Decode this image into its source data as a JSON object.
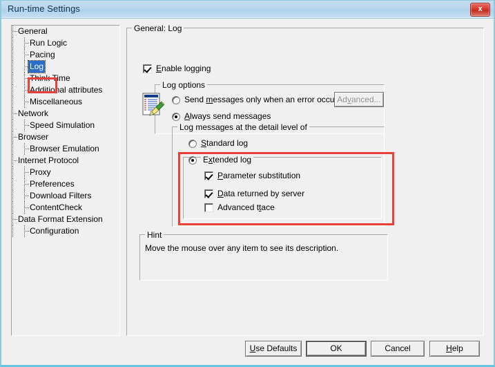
{
  "window": {
    "title": "Run-time Settings",
    "close_label": "x"
  },
  "tree": {
    "items": [
      {
        "label": "General",
        "level": 1,
        "selected": false
      },
      {
        "label": "Run Logic",
        "level": 2,
        "selected": false
      },
      {
        "label": "Pacing",
        "level": 2,
        "selected": false
      },
      {
        "label": "Log",
        "level": 2,
        "selected": true
      },
      {
        "label": "Think Time",
        "level": 2,
        "selected": false
      },
      {
        "label": "Additional attributes",
        "level": 2,
        "selected": false
      },
      {
        "label": "Miscellaneous",
        "level": 2,
        "selected": false
      },
      {
        "label": "Network",
        "level": 1,
        "selected": false
      },
      {
        "label": "Speed Simulation",
        "level": 2,
        "selected": false
      },
      {
        "label": "Browser",
        "level": 1,
        "selected": false
      },
      {
        "label": "Browser Emulation",
        "level": 2,
        "selected": false
      },
      {
        "label": "Internet Protocol",
        "level": 1,
        "selected": false
      },
      {
        "label": "Proxy",
        "level": 2,
        "selected": false
      },
      {
        "label": "Preferences",
        "level": 2,
        "selected": false
      },
      {
        "label": "Download Filters",
        "level": 2,
        "selected": false
      },
      {
        "label": "ContentCheck",
        "level": 2,
        "selected": false
      },
      {
        "label": "Data Format Extension",
        "level": 1,
        "selected": false
      },
      {
        "label": "Configuration",
        "level": 2,
        "selected": false
      }
    ]
  },
  "main": {
    "group_title": "General: Log",
    "enable_logging": {
      "label": "Enable logging",
      "checked": true
    },
    "log_options": {
      "group_title": "Log options",
      "icon": "log-document-pencil-icon",
      "radio_error_only": {
        "label": "Send messages only when an error occurs",
        "selected": false
      },
      "radio_always": {
        "label": "Always send messages",
        "selected": true
      },
      "advanced_button": {
        "label": "Advanced...",
        "enabled": false
      }
    },
    "detail_level": {
      "group_title": "Log messages at the detail level of",
      "radio_standard": {
        "label": "Standard log",
        "selected": false
      },
      "radio_extended": {
        "label": "Extended log",
        "selected": true
      },
      "checkboxes": [
        {
          "label": "Parameter substitution",
          "checked": true
        },
        {
          "label": "Data returned by server",
          "checked": true
        },
        {
          "label": "Advanced trace",
          "checked": false
        }
      ]
    },
    "hint": {
      "group_title": "Hint",
      "text": "Move the mouse over any item to see its description."
    }
  },
  "buttons": {
    "use_defaults": "Use Defaults",
    "ok": "OK",
    "cancel": "Cancel",
    "help": "Help"
  },
  "annotations": {
    "color": "#e8413a",
    "boxes": [
      "tree-log-item",
      "extended-log-group"
    ]
  },
  "colors": {
    "titlebar_blue": "#b9d6ec",
    "selection_blue": "#2a6ec9",
    "dialog_face": "#f0f0f0",
    "close_red": "#d63b2f"
  }
}
